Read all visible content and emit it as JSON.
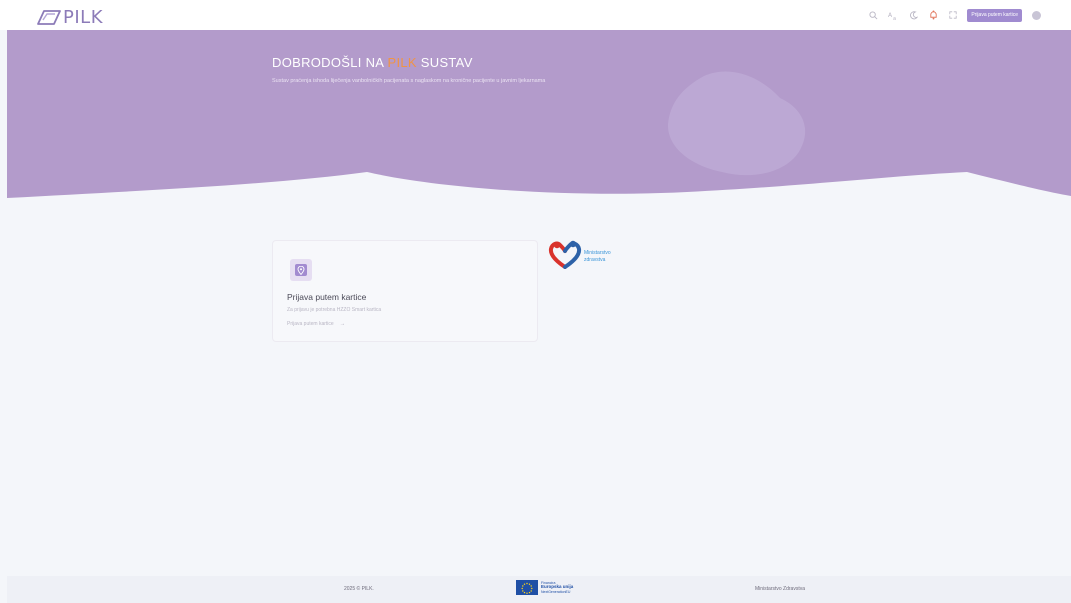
{
  "header": {
    "brand": "PILK",
    "login_button": "Prijava putem kartice",
    "icons": [
      "search-icon",
      "translate-icon",
      "moon-icon",
      "bell-icon",
      "fullscreen-icon",
      "gear-icon"
    ]
  },
  "hero": {
    "title_prefix": "DOBRODOŠLI NA",
    "title_accent": "PILK",
    "title_suffix": "SUSTAV",
    "subtitle": "Sustav praćenja ishoda liječenja vanbolničkih pacijenata s naglaskom na kronične pacijente u javnim ljekarnama"
  },
  "card": {
    "title": "Prijava putem kartice",
    "description": "Za prijavu je potrebna HZZO Smart kartica",
    "link": "Prijava putem kartice"
  },
  "ministry": {
    "line1": "Ministarstvo",
    "line2": "zdravstva"
  },
  "footer": {
    "copyright": "2025 © PILK.",
    "eu_line1": "Financira",
    "eu_line2": "Europska unija",
    "eu_line3": "NextGenerationEU",
    "ministry": "Ministarstvo Zdravstva"
  },
  "colors": {
    "hero_bg": "#b39bcb",
    "accent": "#f09445",
    "primary": "#a08bd0"
  }
}
